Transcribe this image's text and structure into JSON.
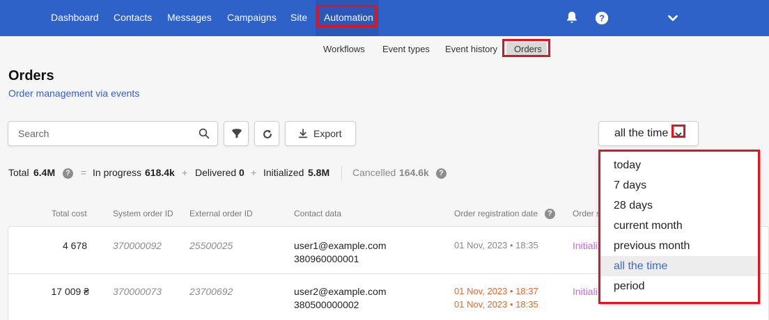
{
  "nav": {
    "items": [
      {
        "label": "Dashboard"
      },
      {
        "label": "Contacts"
      },
      {
        "label": "Messages"
      },
      {
        "label": "Campaigns"
      },
      {
        "label": "Site"
      },
      {
        "label": "Automation",
        "active": true
      }
    ],
    "icons": [
      "bell-icon",
      "help-icon",
      "chevron-down-icon"
    ]
  },
  "subnav": {
    "items": [
      {
        "label": "Workflows"
      },
      {
        "label": "Event types"
      },
      {
        "label": "Event history"
      },
      {
        "label": "Orders",
        "active": true
      }
    ]
  },
  "page": {
    "title": "Orders",
    "subtitle": "Order management via events"
  },
  "toolbar": {
    "search_placeholder": "Search",
    "export_label": "Export",
    "icons": [
      "search-icon",
      "filter-icon",
      "refresh-icon",
      "download-icon"
    ],
    "period": {
      "value": "all the time"
    }
  },
  "stats": {
    "total_label": "Total",
    "total_value": "6.4M",
    "eq": "=",
    "in_progress_label": "In progress",
    "in_progress_value": "618.4k",
    "plus": "+",
    "delivered_label": "Delivered",
    "delivered_value": "0",
    "initialized_label": "Initialized",
    "initialized_value": "5.8M",
    "cancelled_label": "Cancelled",
    "cancelled_value": "164.6k"
  },
  "table": {
    "columns": [
      "Total cost",
      "System order ID",
      "External order ID",
      "Contact data",
      "Order registration date",
      "Order s"
    ],
    "rows": [
      {
        "total": "4 678",
        "system_id": "370000092",
        "external_id": "25500025",
        "email": "user1@example.com",
        "phone": "380960000001",
        "date1": "01 Nov, 2023 • 18:35",
        "status": "Initiali"
      },
      {
        "total": "17 009 ₴",
        "system_id": "370000073",
        "external_id": "23700692",
        "email": "user2@example.com",
        "phone": "380500000002",
        "date1": "01 Nov, 2023 • 18:37",
        "date2": "01 Nov, 2023 • 18:35",
        "status": "Initiali"
      }
    ]
  },
  "period_dropdown": {
    "options": [
      "today",
      "7 days",
      "28 days",
      "current month",
      "previous month",
      "all the time",
      "period"
    ],
    "selected": "all the time"
  },
  "colors": {
    "nav_bg": "#2e62c9",
    "highlight": "#e0141e",
    "link": "#3062c6",
    "warning_date": "#e1672c",
    "status": "#c66ad6"
  }
}
